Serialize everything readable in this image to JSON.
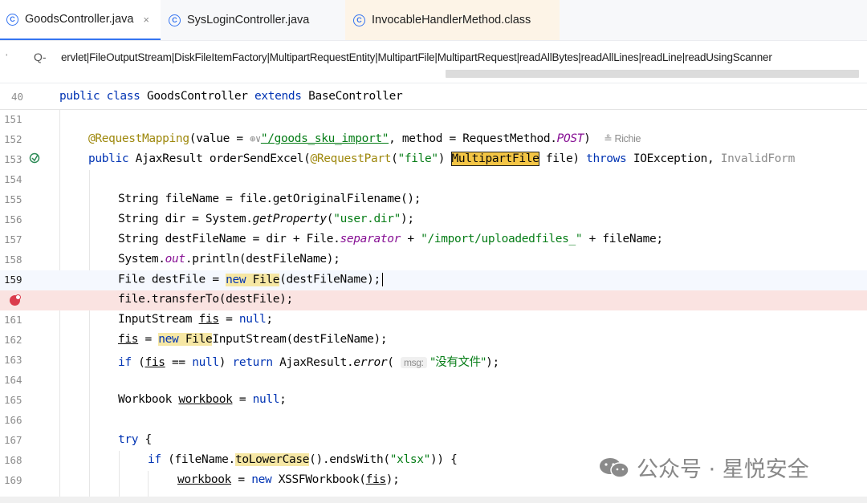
{
  "tabs": [
    {
      "label": "GoodsController.java",
      "close": "×",
      "icon": "C"
    },
    {
      "label": "SysLoginController.java",
      "icon": "C"
    },
    {
      "label": "InvocableHandlerMethod.class",
      "icon": "C"
    }
  ],
  "search": {
    "query": "ervlet|FileOutputStream|DiskFileItemFactory|MultipartRequestEntity|MultipartFile|MultipartRequest|readAllBytes|readAllLines|readLine|readUsingScanner"
  },
  "sticky": {
    "line_number": "40"
  },
  "line_numbers": [
    "151",
    "152",
    "153",
    "154",
    "155",
    "156",
    "157",
    "158",
    "159",
    "",
    "161",
    "162",
    "163",
    "164",
    "165",
    "166",
    "167",
    "168",
    "169"
  ],
  "code": {
    "sticky": {
      "kw1": "public class ",
      "name": "GoodsController ",
      "kw2": "extends ",
      "base": "BaseController"
    },
    "l152": {
      "ann": "@RequestMapping",
      "p1": "(value = ",
      "globe": "⊕∨",
      "val": "\"/goods_sku_import\"",
      "p2": ", method = RequestMethod.",
      "post": "POST",
      "p3": ")",
      "author": "≗ Richie"
    },
    "l153": {
      "kw1": "public ",
      "p1": "AjaxResult orderSendExcel(",
      "ann": "@RequestPart",
      "p2": "(",
      "str": "\"file\"",
      "p3": ") ",
      "hl": "MultipartFile",
      "p4": " file) ",
      "kw2": "throws ",
      "p5": "IOException, ",
      "grey": "InvalidForm"
    },
    "l155": {
      "p1": "String fileName = file.getOriginalFilename();"
    },
    "l156": {
      "p1": "String dir = System.",
      "ital": "getProperty",
      "p2": "(",
      "str": "\"user.dir\"",
      "p3": ");"
    },
    "l157": {
      "p1": "String destFileName = dir + File.",
      "fld": "separator",
      "p2": " + ",
      "str": "\"/import/uploadedfiles_\"",
      "p3": " + fileName;"
    },
    "l158": {
      "p1": "System.",
      "fld": "out",
      "p2": ".println(destFileName);"
    },
    "l159": {
      "p1": "File destFile = ",
      "kw": "new ",
      "hl": "File",
      "p2": "(destFileName);"
    },
    "l160": {
      "p1": "file.transferTo(destFile);"
    },
    "l161": {
      "p1": "InputStream ",
      "var": "fis",
      "p2": " = ",
      "kw": "null",
      "p3": ";"
    },
    "l162": {
      "var": "fis",
      "p1": " = ",
      "kw": "new ",
      "hl": "File",
      "p2": "InputStream(destFileName);"
    },
    "l163": {
      "kw1": "if ",
      "p1": "(",
      "var": "fis",
      "p2": " == ",
      "kw2": "null",
      "p3": ") ",
      "kw3": "return ",
      "p4": "AjaxResult.",
      "ital": "error",
      "p5": "( ",
      "hint": "msg:",
      "str": " \"没有文件\"",
      "p6": ");"
    },
    "l165": {
      "p1": "Workbook ",
      "var": "workbook",
      "p2": " = ",
      "kw": "null",
      "p3": ";"
    },
    "l167": {
      "kw": "try ",
      "p1": "{"
    },
    "l168": {
      "kw": "if ",
      "p1": "(fileName.",
      "ul": "toLowerCase",
      "p2": "().endsWith(",
      "str": "\"xlsx\"",
      "p3": ")) {"
    },
    "l169": {
      "var": "workbook",
      "p1": " = ",
      "kw": "new ",
      "p2": "XSSFWorkbook(",
      "var2": "fis",
      "p3": ");"
    }
  },
  "watermark": {
    "text": "公众号 · 星悦安全"
  },
  "colors": {
    "keyword": "#0033b3",
    "string": "#067d17",
    "annotation": "#9e880d",
    "field": "#871094",
    "breakpoint": "#db3b4b",
    "highlight": "#f6e7a4"
  }
}
